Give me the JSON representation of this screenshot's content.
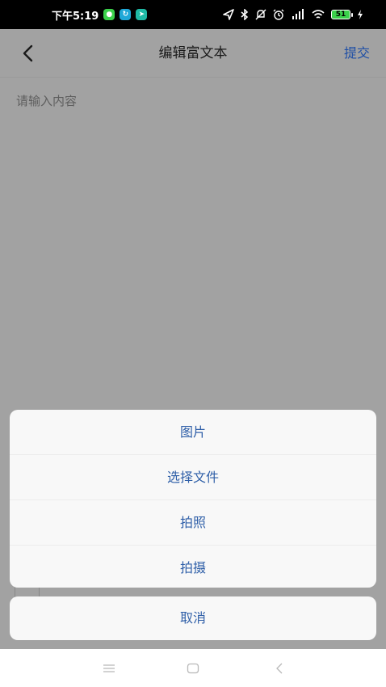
{
  "status_bar": {
    "time": "下午5:19",
    "notifications": [
      {
        "icon": "wechat-icon",
        "color": "#3bd14b"
      },
      {
        "icon": "sync-icon",
        "color": "#1fa8d8"
      },
      {
        "icon": "send-icon",
        "color": "#1fb9a5"
      }
    ],
    "battery_level": "51"
  },
  "header": {
    "title": "编辑富文本",
    "submit_label": "提交",
    "back_icon": "chevron-left-icon"
  },
  "editor": {
    "placeholder": "请输入内容"
  },
  "action_sheet": {
    "items": [
      {
        "label": "图片"
      },
      {
        "label": "选择文件"
      },
      {
        "label": "拍照"
      },
      {
        "label": "拍摄"
      }
    ],
    "cancel_label": "取消"
  },
  "colors": {
    "accent": "#2f5fa8",
    "overlay": "#a2a2a2"
  },
  "navbar": {
    "icons": [
      "menu-icon",
      "home-icon",
      "back-icon"
    ]
  }
}
